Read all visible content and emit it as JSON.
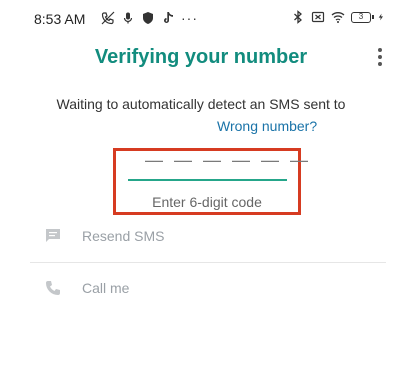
{
  "status_bar": {
    "time": "8:53 AM",
    "left_icons": [
      "muted-call-icon",
      "microphone-icon",
      "shield-icon",
      "tiktok-icon"
    ],
    "more": "···",
    "right_icons": [
      "bluetooth-icon",
      "sim-off-icon",
      "wifi-icon"
    ],
    "battery_level": "3"
  },
  "header": {
    "title": "Verifying your number",
    "menu_icon": "overflow-menu-icon"
  },
  "main": {
    "waiting_text": "Waiting to automatically detect an SMS sent to",
    "wrong_number_link": "Wrong number?",
    "code_placeholder": "— — —   — — —",
    "code_hint": "Enter 6-digit code",
    "highlight_color": "#d63b21",
    "accent_color": "#128c7e"
  },
  "options": {
    "resend_sms": {
      "label": "Resend SMS",
      "icon": "message-icon"
    },
    "call_me": {
      "label": "Call me",
      "icon": "phone-icon"
    }
  }
}
